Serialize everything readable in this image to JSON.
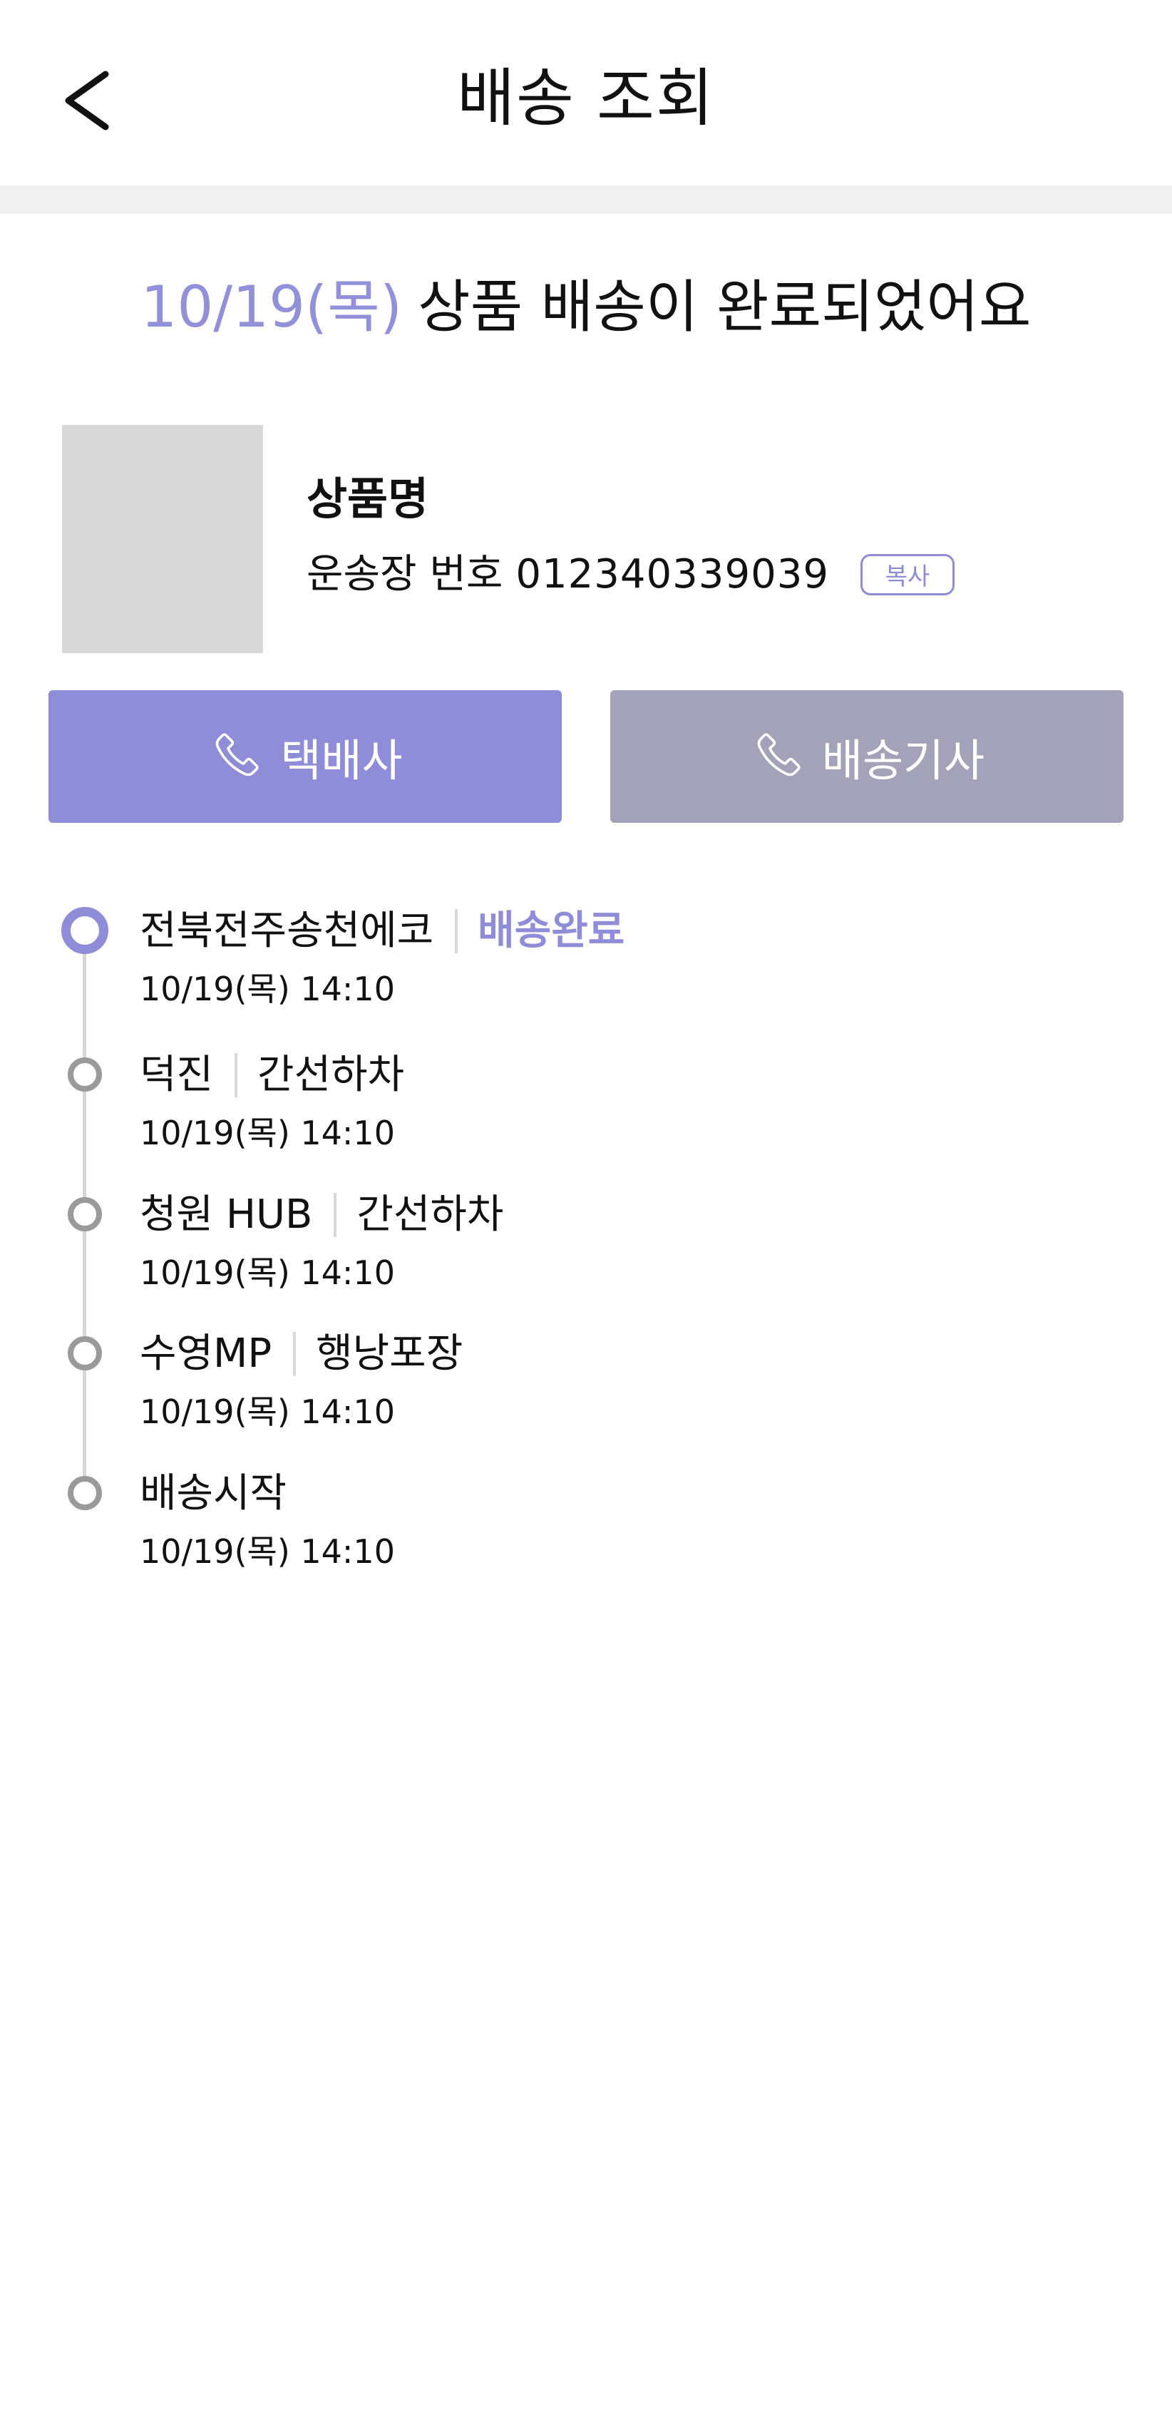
{
  "header": {
    "title": "배송 조회",
    "back_icon": "chevron-left-icon"
  },
  "headline": {
    "date": "10/19(목)",
    "text": "상품 배송이 완료되었어요",
    "accent_color": "#9290d8"
  },
  "product": {
    "name": "상품명",
    "tracking_label": "운송장 번호",
    "tracking_number": "012340339039",
    "copy_label": "복사"
  },
  "buttons": {
    "courier": {
      "label": "택배사",
      "icon": "phone-icon",
      "color": "#8f8cd8"
    },
    "driver": {
      "label": "배송기사",
      "icon": "phone-icon",
      "color": "#a3a2b8"
    }
  },
  "timeline": [
    {
      "location": "전북전주송천에코",
      "status": "배송완료",
      "time": "10/19(목) 14:10",
      "active": true
    },
    {
      "location": "덕진",
      "status": "간선하차",
      "time": "10/19(목) 14:10",
      "active": false
    },
    {
      "location": "청원 HUB",
      "status": "간선하차",
      "time": "10/19(목) 14:10",
      "active": false
    },
    {
      "location": "수영MP",
      "status": "행낭포장",
      "time": "10/19(목) 14:10",
      "active": false
    },
    {
      "location": "배송시작",
      "status": "",
      "time": "10/19(목) 14:10",
      "active": false
    }
  ]
}
